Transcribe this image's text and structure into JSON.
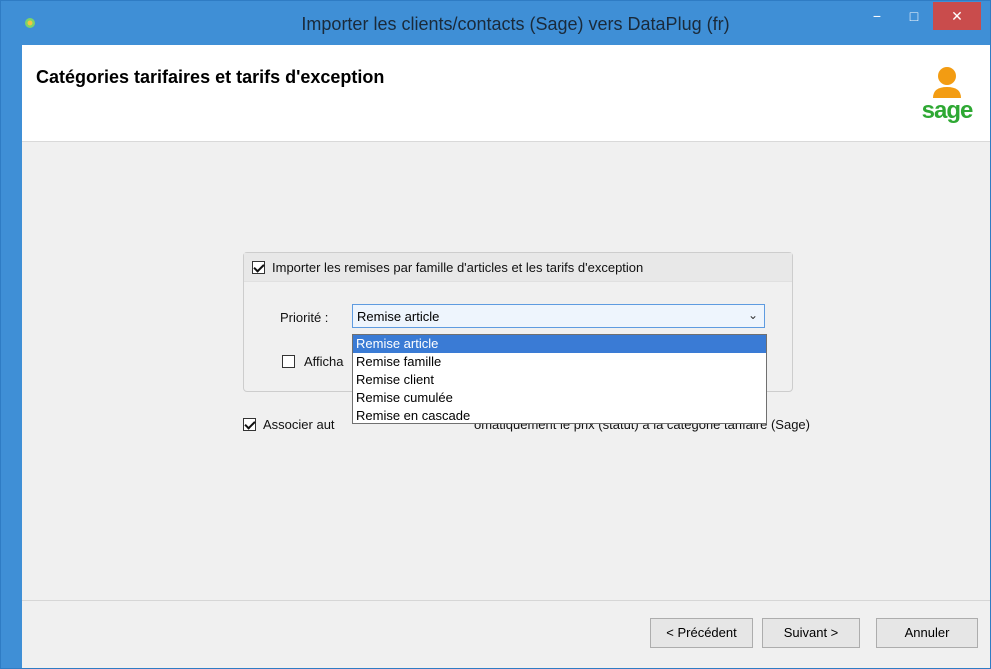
{
  "window": {
    "title": "Importer les clients/contacts (Sage) vers DataPlug (fr)",
    "min_glyph": "−",
    "max_glyph": "□",
    "close_glyph": "✕",
    "accent_color": "#3f8fd6",
    "close_color": "#c94c4c"
  },
  "header": {
    "title": "Catégories tarifaires et tarifs d'exception",
    "logo_text": "sage",
    "logo_color": "#2ea833"
  },
  "options": {
    "import_discounts_label": "Importer les remises par famille d'articles et les tarifs d'exception",
    "import_discounts_checked": true,
    "priority_label": "Priorité :",
    "priority_value": "Remise article",
    "priority_options": [
      "Remise article",
      "Remise famille",
      "Remise client",
      "Remise cumulée",
      "Remise en cascade"
    ],
    "display_label": "Afficha",
    "display_checked": false,
    "associate_label_start": "Associer aut",
    "associate_label_end": "omatiquement le prix (statut) à la catégorie tarifaire (Sage)",
    "associate_checked": true
  },
  "footer": {
    "prev_label": "< Précédent",
    "next_label": "Suivant >",
    "cancel_label": "Annuler"
  }
}
